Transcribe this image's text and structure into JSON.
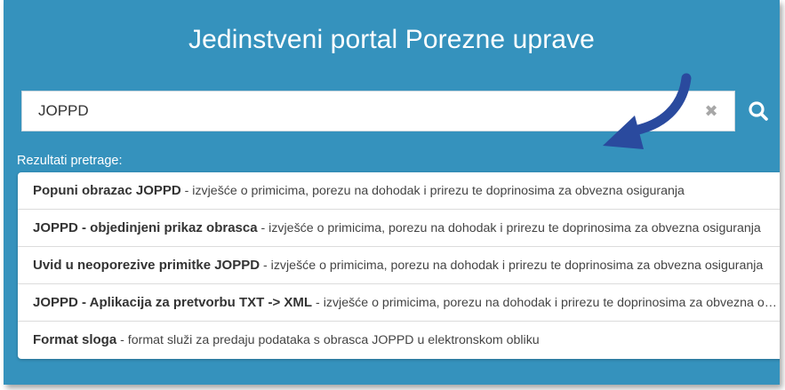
{
  "header": {
    "title": "Jedinstveni portal Porezne uprave"
  },
  "search": {
    "value": "JOPPD",
    "clear_icon": "close-icon",
    "search_icon": "search-icon"
  },
  "results": {
    "label": "Rezultati pretrage:",
    "items": [
      {
        "title": "Popuni obrazac JOPPD",
        "description": " - izvješće o primicima, porezu na dohodak i prirezu te doprinosima za obvezna osiguranja"
      },
      {
        "title": "JOPPD - objedinjeni prikaz obrasca",
        "description": " - izvješće o primicima, porezu na dohodak i prirezu te doprinosima za obvezna osiguranja"
      },
      {
        "title": "Uvid u neoporezive primitke JOPPD",
        "description": " - izvješće o primicima, porezu na dohodak i prirezu te doprinosima za obvezna osiguranja"
      },
      {
        "title": "JOPPD - Aplikacija za pretvorbu TXT -> XML",
        "description": " - izvješće o primicima, porezu na dohodak i prirezu te doprinosima za obvezna osiguranja"
      },
      {
        "title": "Format sloga",
        "description": " - format služi za predaju podataka s obrasca JOPPD u elektronskom obliku"
      }
    ]
  },
  "colors": {
    "background": "#3592bd",
    "arrow": "#2a4a9e"
  }
}
